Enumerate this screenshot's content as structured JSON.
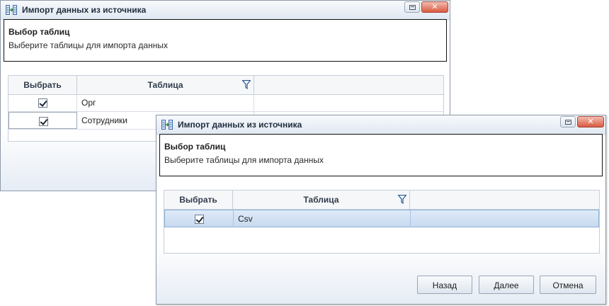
{
  "back_window": {
    "title": "Импорт данных из источника",
    "header": {
      "title": "Выбор таблиц",
      "subtitle": "Выберите таблицы для импорта данных"
    },
    "grid": {
      "columns": [
        "Выбрать",
        "Таблица"
      ],
      "rows": [
        {
          "checked": true,
          "table": "Орг"
        },
        {
          "checked": true,
          "table": "Сотрудники"
        }
      ]
    }
  },
  "front_window": {
    "title": "Импорт данных из источника",
    "header": {
      "title": "Выбор таблиц",
      "subtitle": "Выберите таблицы для импорта данных"
    },
    "grid": {
      "columns": [
        "Выбрать",
        "Таблица"
      ],
      "rows": [
        {
          "checked": true,
          "table": "Csv",
          "selected": true
        }
      ]
    },
    "buttons": {
      "back": "Назад",
      "next": "Далее",
      "cancel": "Отмена"
    }
  },
  "icons": {
    "app": "import-data-icon",
    "restore": "restore-icon",
    "close": "close-icon",
    "filter": "filter-icon",
    "checkbox": "checkbox-checked-icon"
  },
  "colors": {
    "selection": "#c8daf0",
    "close_button": "#d9593f",
    "border": "#8e9aa8"
  }
}
